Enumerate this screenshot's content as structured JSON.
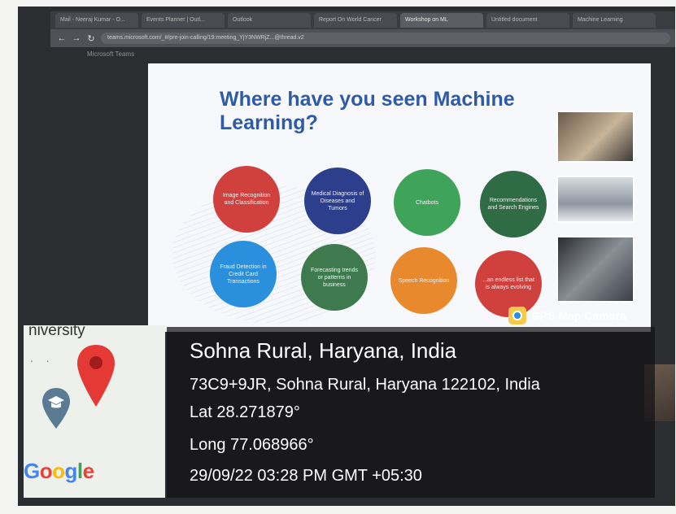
{
  "browser": {
    "tabs": [
      {
        "label": "Mail - Neeraj Kumar - O..."
      },
      {
        "label": "Events Planner | Outl..."
      },
      {
        "label": "Outlook"
      },
      {
        "label": "Report On World Cancer"
      },
      {
        "label": "Workshop on ML",
        "active": true
      },
      {
        "label": "Untitled document"
      },
      {
        "label": "Machine Learning"
      }
    ],
    "url": "teams.microsoft.com/_#/pre-join-calling/19:meeting_YjY3NWRjZ...@thread.v2",
    "app_label": "Microsoft Teams"
  },
  "slide": {
    "title": "Where have you seen Machine Learning?",
    "circles": [
      {
        "text": "Image Recognition and Classification",
        "color": "#d0403c"
      },
      {
        "text": "Medical Diagnosis of Diseases and Tumors",
        "color": "#2d3f8c"
      },
      {
        "text": "Chatbots",
        "color": "#3fa35a"
      },
      {
        "text": "Recommendations and Search Engines",
        "color": "#2f6b45"
      },
      {
        "text": "Fraud Detection in Credit Card Transactions",
        "color": "#2a8fdc"
      },
      {
        "text": "Forecasting trends or patterns in business",
        "color": "#3f7a4f"
      },
      {
        "text": "Speech Recognition",
        "color": "#e8892e"
      },
      {
        "text": "...an endless list that is always evolving",
        "color": "#d0403c"
      }
    ]
  },
  "gps_badge": {
    "label": "GPS Map Camera"
  },
  "map": {
    "label": "niversity",
    "dots": ". .",
    "logo_letters": [
      {
        "ch": "G",
        "color": "#4285f4"
      },
      {
        "ch": "o",
        "color": "#ea4335"
      },
      {
        "ch": "o",
        "color": "#fbbc05"
      },
      {
        "ch": "g",
        "color": "#4285f4"
      },
      {
        "ch": "l",
        "color": "#34a853"
      },
      {
        "ch": "e",
        "color": "#ea4335"
      }
    ]
  },
  "location": {
    "place": "Sohna Rural, Haryana, India",
    "address": "73C9+9JR, Sohna Rural, Haryana 122102, India",
    "lat": "Lat 28.271879°",
    "long": "Long 77.068966°",
    "datetime": "29/09/22 03:28 PM GMT +05:30"
  }
}
